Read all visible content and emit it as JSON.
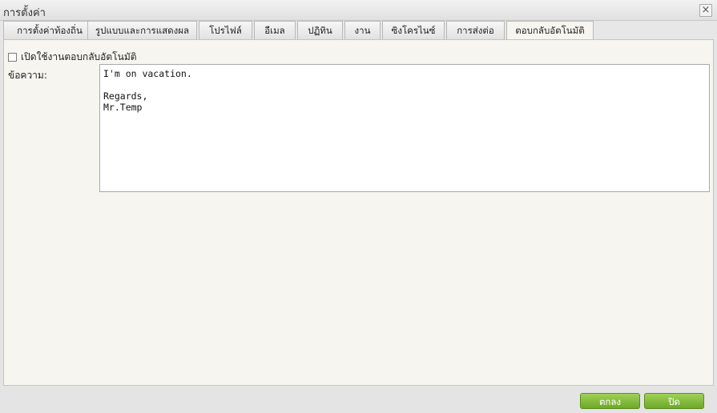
{
  "window": {
    "title": "การตั้งค่า",
    "close_glyph": "×"
  },
  "tabs": [
    {
      "label": "การตั้งค่าท้องถิ่น"
    },
    {
      "label": "รูปแบบและการแสดงผล"
    },
    {
      "label": "โปรไฟล์"
    },
    {
      "label": "อีเมล"
    },
    {
      "label": "ปฏิทิน"
    },
    {
      "label": "งาน"
    },
    {
      "label": "ซิงโครไนซ์"
    },
    {
      "label": "การส่งต่อ"
    },
    {
      "label": "ตอบกลับอัตโนมัติ"
    }
  ],
  "active_tab": "ตอบกลับอัตโนมัติ",
  "autoreply": {
    "enable_label": "เปิดใช้งานตอบกลับอัตโนมัติ",
    "enabled": false,
    "message_label": "ข้อความ:",
    "message_text": "I'm on vacation.\n\nRegards,\nMr.Temp"
  },
  "footer": {
    "ok_label": "ตกลง",
    "close_label": "ปิด"
  },
  "colors": {
    "button_green": "#7db83a",
    "panel_bg": "#f6f5f0"
  }
}
